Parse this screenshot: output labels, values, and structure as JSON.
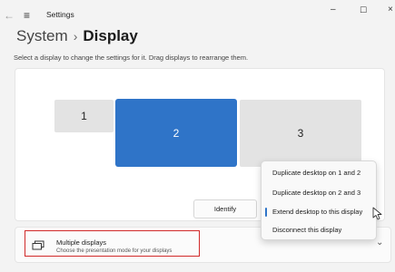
{
  "window": {
    "back_glyph": "←",
    "menu_glyph": "≡",
    "title": "Settings",
    "minimize_glyph": "–",
    "maximize_glyph": "☐",
    "close_glyph": "×"
  },
  "header": {
    "parent": "System",
    "separator": "›",
    "current": "Display"
  },
  "instruction": "Select a display to change the settings for it. Drag displays to rearrange them.",
  "displays": [
    {
      "label": "1",
      "selected": false
    },
    {
      "label": "2",
      "selected": true
    },
    {
      "label": "3",
      "selected": false
    }
  ],
  "identify_label": "Identify",
  "context_menu": {
    "items": [
      {
        "label": "Duplicate desktop on 1 and 2"
      },
      {
        "label": "Duplicate desktop on 2 and 3"
      },
      {
        "label": "Extend desktop to this display",
        "selected": true
      },
      {
        "label": "Disconnect this display"
      }
    ]
  },
  "multiple_displays": {
    "title": "Multiple displays",
    "subtitle": "Choose the presentation mode for your displays",
    "icon": "multiple-displays-icon",
    "chevron_glyph": "⌄"
  },
  "colors": {
    "accent": "#2f74c8",
    "highlight": "#d12a2a",
    "background": "#f3f3f3"
  }
}
